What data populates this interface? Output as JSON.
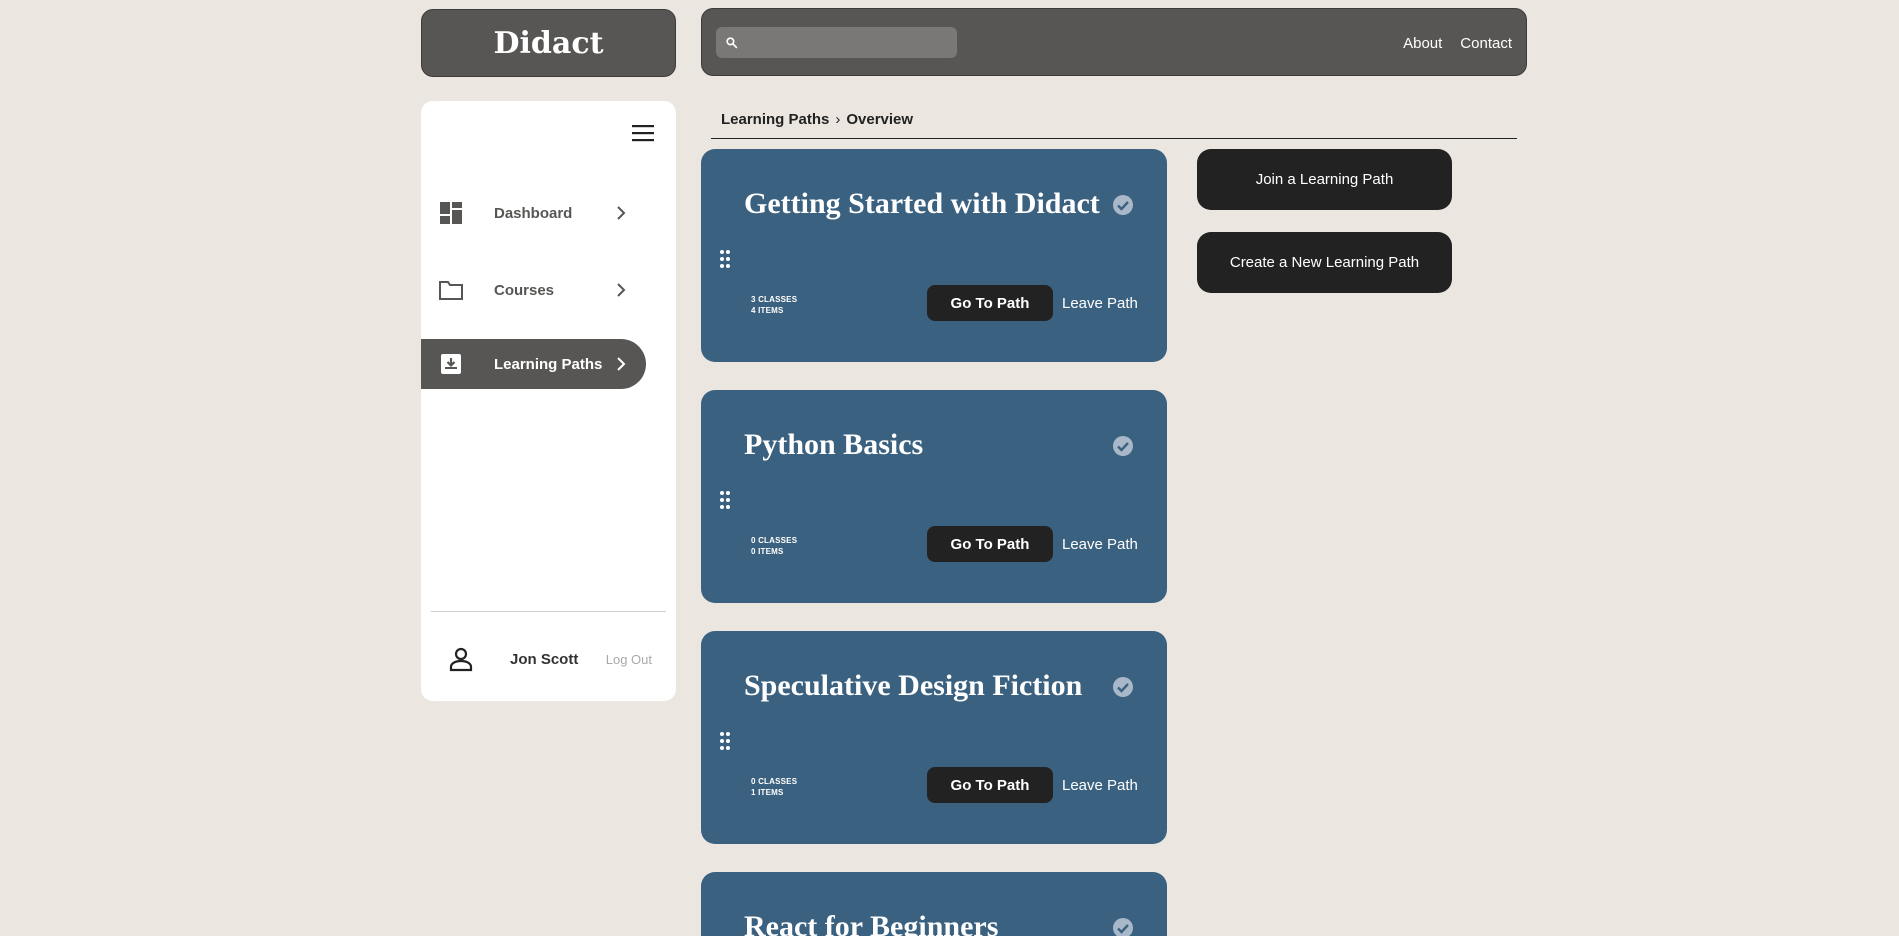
{
  "logo": "Didact",
  "search": {
    "placeholder": ""
  },
  "topnav": {
    "about": "About",
    "contact": "Contact"
  },
  "sidebar": {
    "items": [
      {
        "label": "Dashboard",
        "icon": "dashboard-icon"
      },
      {
        "label": "Courses",
        "icon": "folder-icon"
      },
      {
        "label": "Learning Paths",
        "icon": "learning-path-icon",
        "active": true
      }
    ],
    "user": {
      "name": "Jon Scott",
      "logout": "Log Out"
    }
  },
  "breadcrumb": {
    "parent": "Learning Paths",
    "separator": "›",
    "current": "Overview"
  },
  "cards": [
    {
      "title": "Getting Started with Didact",
      "classes": "3 CLASSES",
      "items": "4 ITEMS",
      "go": "Go To Path",
      "leave": "Leave Path"
    },
    {
      "title": "Python Basics",
      "classes": "0 CLASSES",
      "items": "0 ITEMS",
      "go": "Go To Path",
      "leave": "Leave Path"
    },
    {
      "title": "Speculative Design Fiction",
      "classes": "0 CLASSES",
      "items": "1 ITEMS",
      "go": "Go To Path",
      "leave": "Leave Path"
    },
    {
      "title": "React for Beginners",
      "classes": "",
      "items": "",
      "go": "",
      "leave": ""
    }
  ],
  "actions": {
    "join": "Join a Learning Path",
    "create": "Create a New Learning Path"
  },
  "colors": {
    "background": "#ebe7e0",
    "header": "#585654",
    "card": "#3b6180",
    "button": "#222222"
  }
}
